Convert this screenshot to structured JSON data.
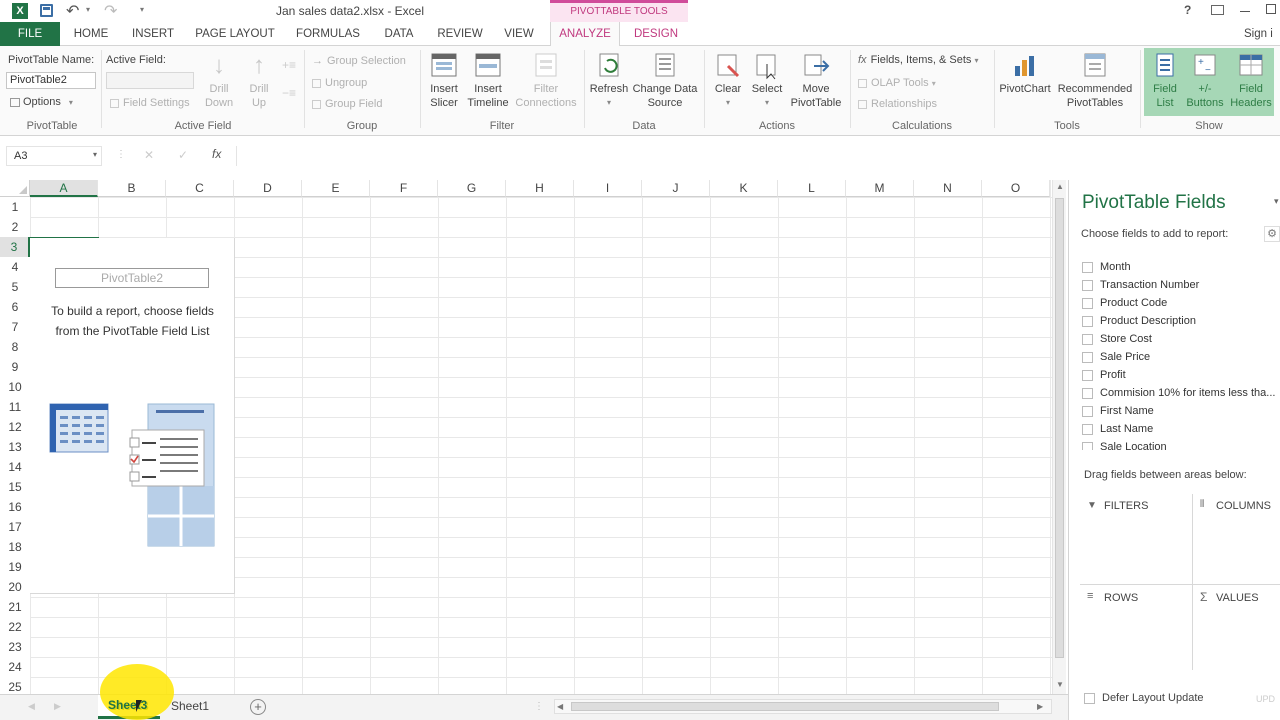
{
  "window": {
    "title": "Jan sales data2.xlsx - Excel",
    "contextual_tab_group": "PIVOTTABLE TOOLS",
    "help": "?"
  },
  "tabs": [
    "FILE",
    "HOME",
    "INSERT",
    "PAGE LAYOUT",
    "FORMULAS",
    "DATA",
    "REVIEW",
    "VIEW",
    "ANALYZE",
    "DESIGN"
  ],
  "signin": "Sign i",
  "ribbon": {
    "pivottable": {
      "name_label": "PivotTable Name:",
      "name_value": "PivotTable2",
      "options": "Options",
      "group": "PivotTable"
    },
    "active_field": {
      "label": "Active Field:",
      "field_settings": "Field Settings",
      "drill_down": [
        "Drill",
        "Down"
      ],
      "drill_up": [
        "Drill",
        "Up"
      ],
      "group": "Active Field"
    },
    "group": {
      "group_selection": "Group Selection",
      "ungroup": "Ungroup",
      "group_field": "Group Field",
      "group": "Group"
    },
    "filter": {
      "insert_slicer": [
        "Insert",
        "Slicer"
      ],
      "insert_timeline": [
        "Insert",
        "Timeline"
      ],
      "filter_connections": [
        "Filter",
        "Connections"
      ],
      "group": "Filter"
    },
    "data": {
      "refresh": "Refresh",
      "change_data_source": [
        "Change Data",
        "Source"
      ],
      "group": "Data"
    },
    "actions": {
      "clear": "Clear",
      "select": "Select",
      "move_pivottable": [
        "Move",
        "PivotTable"
      ],
      "group": "Actions"
    },
    "calculations": {
      "fields_items_sets": "Fields, Items, & Sets",
      "olap_tools": "OLAP Tools",
      "relationships": "Relationships",
      "group": "Calculations"
    },
    "tools": {
      "pivotchart": "PivotChart",
      "recommended": [
        "Recommended",
        "PivotTables"
      ],
      "group": "Tools"
    },
    "show": {
      "field_list": [
        "Field",
        "List"
      ],
      "buttons": [
        "+/-",
        "Buttons"
      ],
      "field_headers": [
        "Field",
        "Headers"
      ],
      "group": "Show"
    }
  },
  "formula_bar": {
    "name_box": "A3",
    "fx": "fx",
    "cancel": "✕",
    "enter": "✓"
  },
  "columns": [
    "A",
    "B",
    "C",
    "D",
    "E",
    "F",
    "G",
    "H",
    "I",
    "J",
    "K",
    "L",
    "M",
    "N",
    "O"
  ],
  "rows": [
    "1",
    "2",
    "3",
    "4",
    "5",
    "6",
    "7",
    "8",
    "9",
    "10",
    "11",
    "12",
    "13",
    "14",
    "15",
    "16",
    "17",
    "18",
    "19",
    "20",
    "21",
    "22",
    "23",
    "24",
    "25"
  ],
  "pivot_placeholder": {
    "name": "PivotTable2",
    "instructions_line1": "To build a report, choose fields",
    "instructions_line2": "from the PivotTable Field List"
  },
  "field_pane": {
    "title": "PivotTable Fields",
    "choose_label": "Choose fields to add to report:",
    "fields": [
      "Month",
      "Transaction Number",
      "Product Code",
      "Product Description",
      "Store Cost",
      "Sale Price",
      "Profit",
      "Commision 10% for items less tha...",
      "First Name",
      "Last Name",
      "Sale Location"
    ],
    "drag_label": "Drag fields between areas below:",
    "areas": {
      "filters": "FILTERS",
      "columns": "COLUMNS",
      "rows": "ROWS",
      "values": "VALUES"
    },
    "defer": "Defer Layout Update",
    "update": "UPD"
  },
  "sheet_tabs": [
    "Sheet3",
    "Sheet1"
  ],
  "colors": {
    "file_tab": "#217346",
    "accent": "#217346",
    "context_tab": "#d04c9a",
    "selected_show": "#a6d7b6"
  }
}
